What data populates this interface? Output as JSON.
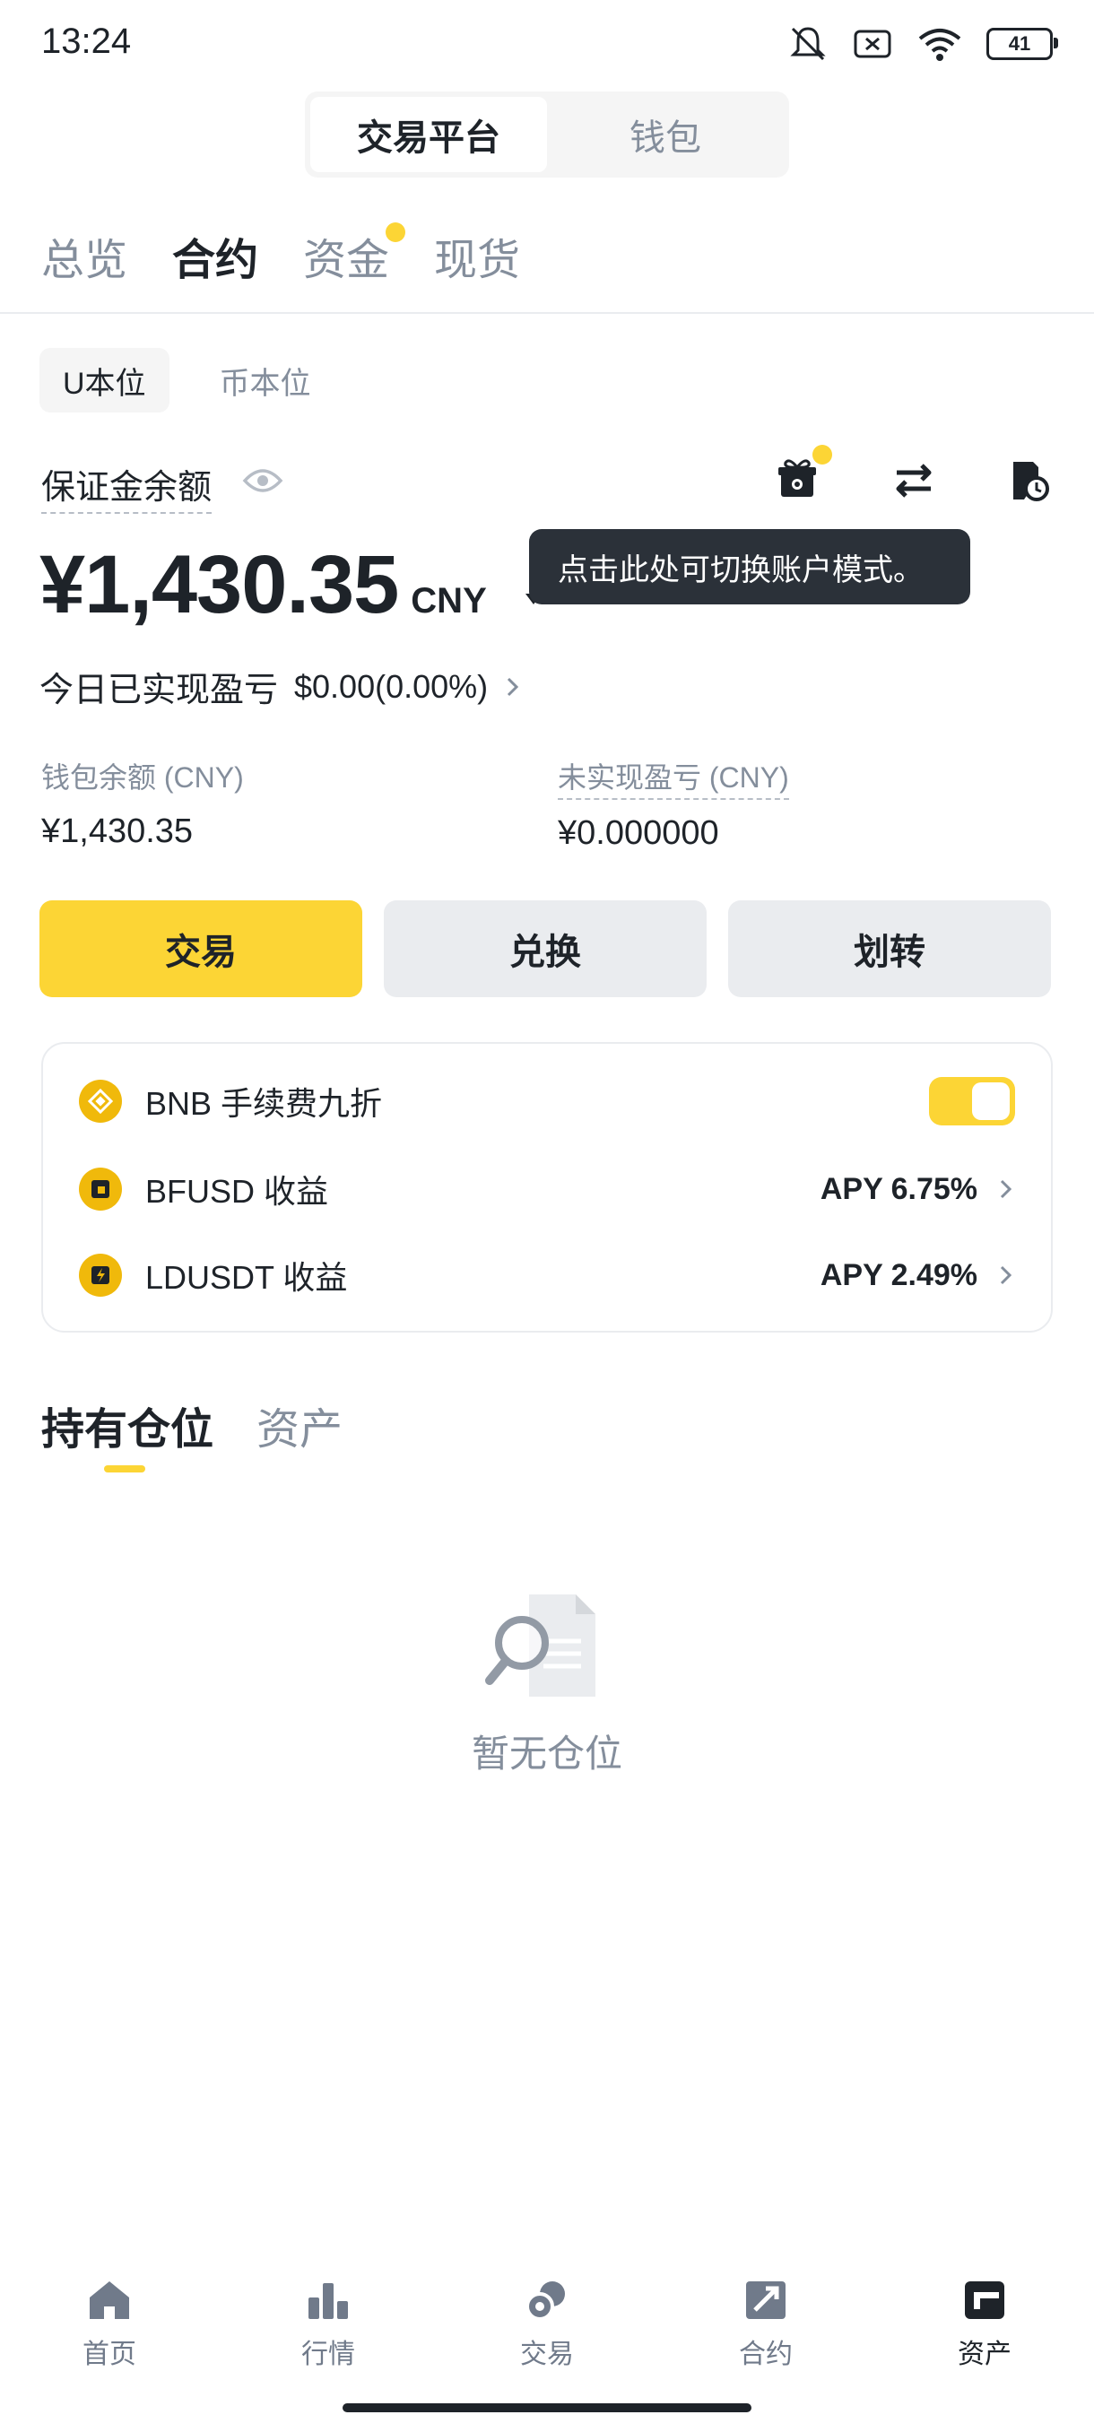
{
  "status_bar": {
    "time": "13:24",
    "battery": "41"
  },
  "segment": {
    "items": [
      "交易平台",
      "钱包"
    ],
    "active": 0
  },
  "top_tabs": [
    "总览",
    "合约",
    "资金",
    "现货"
  ],
  "sub_tabs": [
    "U本位",
    "币本位"
  ],
  "margin": {
    "label": "保证金余额",
    "value": "¥1,430.35",
    "currency": "CNY",
    "tooltip": "点击此处可切换账户模式。"
  },
  "pnl": {
    "label": "今日已实现盈亏",
    "value": "$0.00(0.00%)"
  },
  "wallet": {
    "label": "钱包余额 (CNY)",
    "value": "¥1,430.35"
  },
  "unrealized": {
    "label": "未实现盈亏 (CNY)",
    "value": "¥0.000000"
  },
  "buttons": {
    "trade": "交易",
    "convert": "兑换",
    "transfer": "划转"
  },
  "card": {
    "bnb": {
      "label": "BNB 手续费九折",
      "enabled": true
    },
    "bfusd": {
      "label": "BFUSD 收益",
      "apy": "APY 6.75%"
    },
    "ldusdt": {
      "label": "LDUSDT 收益",
      "apy": "APY 2.49%"
    }
  },
  "position_tabs": [
    "持有仓位",
    "资产"
  ],
  "empty": {
    "text": "暂无仓位"
  },
  "bottom_nav": [
    "首页",
    "行情",
    "交易",
    "合约",
    "资产"
  ],
  "colors": {
    "accent": "#fcd535",
    "text": "#1e2329",
    "muted": "#848e9c"
  }
}
